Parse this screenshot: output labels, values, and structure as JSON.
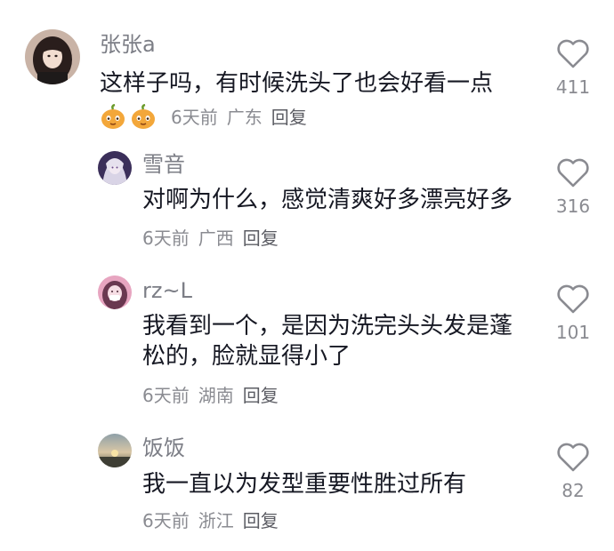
{
  "comments": [
    {
      "username": "张张a",
      "text": "这样子吗，有时候洗头了也会好看一点",
      "date": "6天前",
      "location": "广东",
      "reply_label": "回复",
      "likes": "411",
      "emoji_icons": [
        "pumpkin-emoji-icon",
        "pumpkin-emoji-icon"
      ]
    },
    {
      "username": "雪音",
      "text": "对啊为什么，感觉清爽好多漂亮好多",
      "date": "6天前",
      "location": "广西",
      "reply_label": "回复",
      "likes": "316"
    },
    {
      "username": "rz~L",
      "text": "我看到一个，是因为洗完头头发是蓬\n松的，脸就显得小了",
      "date": "6天前",
      "location": "湖南",
      "reply_label": "回复",
      "likes": "101"
    },
    {
      "username": "饭饭",
      "text": "我一直以为发型重要性胜过所有",
      "date": "6天前",
      "location": "浙江",
      "reply_label": "回复",
      "likes": "82"
    }
  ],
  "colors": {
    "username": "#7c7e86",
    "text": "#161823",
    "meta": "#8a8b91",
    "heart_stroke": "#8a8b91"
  }
}
